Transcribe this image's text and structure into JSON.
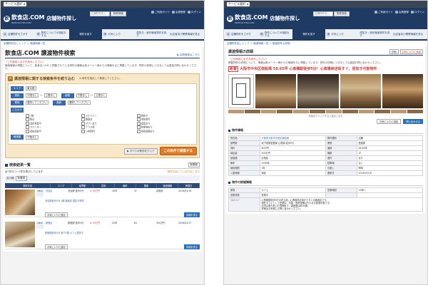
{
  "left": {
    "topbar": {
      "selector": "サービス選択"
    },
    "header": {
      "logo_name": "飲食店.COM",
      "logo_sub": "INSHOKUTEN.COM",
      "site_title": "店舗物件探し",
      "search_placeholder": "店舗物件探し",
      "search_button": "物件検索",
      "links": [
        "ご利用ガイド",
        "会員登録",
        "ログイン"
      ]
    },
    "nav": [
      {
        "label": "店舗物件をさがす"
      },
      {
        "label": "物件についての相談をする"
      },
      {
        "label": "物件を探す"
      },
      {
        "label": "お気に入り"
      },
      {
        "label": "居抜き・造作譲渡物件を探す"
      },
      {
        "label": "出店者向け開業情報を見る"
      }
    ],
    "breadcrumb": "店舗物件探しトップ ＞ 譲渡情報一覧",
    "page_title": "飲食店.COM 譲渡物件検索",
    "page_title_right": "▶ 会員登録はこちら",
    "notice_red": "〈ご利用前に必ずお読みください〉",
    "notice_body": "譲渡情報の掲載について、飲食店.COM に掲載されている物件の情報は各オーナー様からの情報を元に掲載しています。物件の詳細につきましては直接お問い合わせください。",
    "search": {
      "heading": "譲渡情報に関する検索条件を絞り込む",
      "hint": "※ 条件を指定して検索してください。",
      "area_label": "エリア",
      "area_value": "東京都",
      "rent_label": "賃料",
      "rent_from": "下限なし",
      "rent_to": "上限なし",
      "size_label": "面積",
      "size_from": "下限なし",
      "size_to": "上限なし",
      "range_sep": "〜",
      "type_label": "業態",
      "type_value": "選択してください",
      "floor_label": "階数",
      "floor_value": "選択してください",
      "features_label": "こだわり",
      "features": [
        "1階",
        "スケルトン",
        "居抜き",
        "駅近",
        "路面店",
        "重飲食可",
        "深夜営業可",
        "ダクトあり",
        "個室あり",
        "カウンター",
        "テラス席",
        "駐車場あり",
        "看板設置可",
        "24時間可",
        "厨房設備あり"
      ],
      "price_label": "譲渡額",
      "price_value": "下限なし",
      "clear_button": "▶ すべての条件をクリア",
      "search_button": "この条件で検索する"
    },
    "results": {
      "heading": "検索結果一覧",
      "heading_button": "新着順",
      "count_total": "7",
      "count_text": "全7件中 1〜7件を表示しています",
      "more_link": "物件を探している方はこちら",
      "sort_label": "並び順",
      "sort_value": "新着順",
      "columns": [
        "物件写真",
        "エリア",
        "最寄駅",
        "賃料",
        "面積",
        "階数",
        "譲渡価格",
        "掲載日"
      ],
      "rows": [
        {
          "badge": "NEW",
          "area": "渋谷区",
          "station": "渋谷駅 徒歩5分",
          "rent": "★ 65万円",
          "size": "30坪",
          "floor": "1F",
          "price": "応相談",
          "date": "2016/02/18",
          "desc": "渋谷駅徒歩5分 1階 路面店 居抜き物件",
          "fav": "お気に入りに追加",
          "detail": "詳細を見る"
        },
        {
          "badge": "NEW",
          "area": "新宿区",
          "station": "新宿駅 徒歩3分",
          "rent": "★ 45万円",
          "size": "22坪",
          "floor": "B1",
          "price": "300万円",
          "date": "2016/02/17",
          "desc": "新宿駅徒歩3分 地下1階 カフェ居抜き",
          "fav": "お気に入りに追加",
          "detail": "詳細を見る"
        }
      ]
    }
  },
  "right": {
    "topbar": {
      "selector": "サービス選択"
    },
    "header": {
      "logo_name": "飲食店.COM",
      "logo_sub": "INSHOKUTEN.COM",
      "site_title": "店舗物件探し",
      "search_placeholder": "店舗物件探し",
      "search_button": "物件検索",
      "links": [
        "ご利用ガイド",
        "会員登録",
        "ログイン"
      ]
    },
    "nav": [
      {
        "label": "店舗物件をさがす"
      },
      {
        "label": "物件についての相談をする"
      },
      {
        "label": "物件を探す"
      },
      {
        "label": "お気に入り"
      },
      {
        "label": "居抜き・造作譲渡物件を探す"
      },
      {
        "label": "出店者向け開業情報を見る"
      }
    ],
    "breadcrumb": "店舗物件探しトップ ＞ 譲渡情報一覧 ＞ 譲渡物件の詳細",
    "page_title": "譲渡情報の詳細",
    "print_button": "印刷",
    "fav_button": "お気に入りに追加",
    "notice_red": "〈ご利用前に必ずお読みください〉",
    "notice_body": "掲載物件の詳細について、情報は各オーナー様からの情報を元に掲載しています。物件の詳細につきましては直接お問い合わせください。",
    "headline_tag": "新着",
    "headline": "大阪市中央区南船場 58.65坪 心斎橋駅徒歩5分！心斎橋商店街すぐ、居抜き可能物件",
    "photo_caption": "写真をクリックすると拡大します",
    "actions": {
      "fav": "お気に入りに追加",
      "contact": "問い合わせる"
    },
    "info_section": "物件情報",
    "info": [
      [
        "所在地",
        "大阪府大阪市中央区南船場",
        "物件種別",
        "店舗"
      ],
      [
        "最寄駅",
        "地下鉄御堂筋線 心斎橋 徒歩5分",
        "業態",
        "居酒屋"
      ],
      [
        "賃料",
        "60万円",
        "面積",
        "58.65坪"
      ],
      [
        "保証金",
        "500万円",
        "階数",
        "1F"
      ],
      [
        "譲渡額",
        "応相談",
        "造作",
        "あり"
      ],
      [
        "築年",
        "1990年",
        "駐車場",
        "なし"
      ],
      [
        "契約期間",
        "3年",
        "引渡し",
        "即時"
      ],
      [
        "入居時期",
        "相談",
        "更新日",
        "2016/02/18"
      ]
    ],
    "detail_section": "物件の詳細情報",
    "detail_rows": [
      [
        "業態",
        "カフェ",
        "営業時間",
        "11時〜"
      ],
      [
        "営業状態",
        "営業中",
        "",
        ""
      ]
    ],
    "comment_label": "コメント",
    "comment_lines": [
      "心斎橋駅徒歩5分の好立地。心斎橋商店街からすぐの路面店です。",
      "現在カフェとして営業中。内装・厨房設備はそのまま譲渡可能です。",
      "店内は落ち着いた雰囲気で、客席数は約40席。",
      "詳細はお気軽にお問い合わせください。"
    ]
  }
}
